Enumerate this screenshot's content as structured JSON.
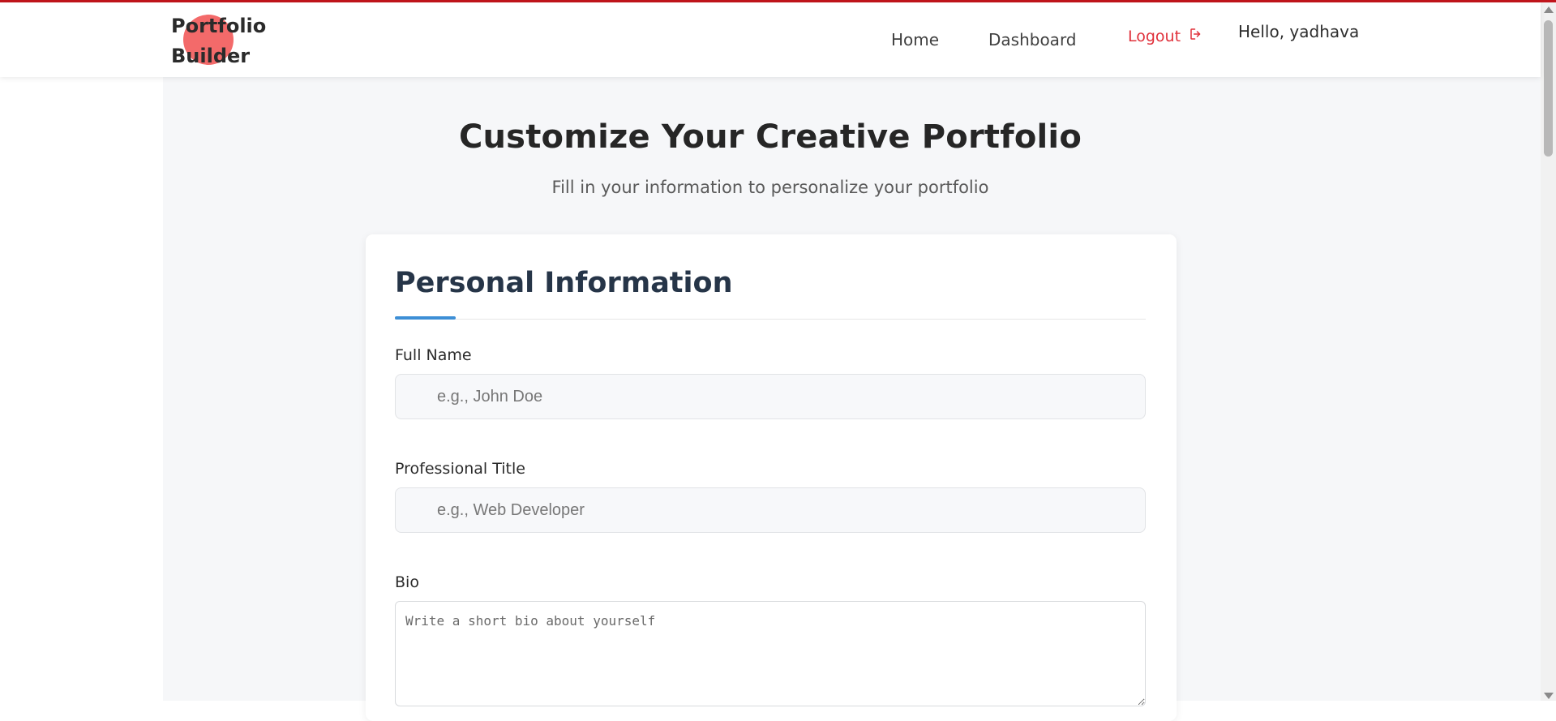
{
  "app": {
    "logo_text": "Portfolio Builder"
  },
  "nav": {
    "home": "Home",
    "dashboard": "Dashboard",
    "logout": "Logout",
    "greeting": "Hello, yadhava"
  },
  "hero": {
    "title": "Customize Your Creative Portfolio",
    "subtitle": "Fill in your information to personalize your portfolio"
  },
  "section": {
    "title": "Personal Information"
  },
  "form": {
    "full_name_label": "Full Name",
    "full_name_placeholder": "e.g., John Doe",
    "title_label": "Professional Title",
    "title_placeholder": "e.g., Web Developer",
    "bio_label": "Bio",
    "bio_placeholder": "Write a short bio about yourself"
  },
  "colors": {
    "accent": "#3d8fd6",
    "logout": "#e0303a",
    "logo_dot": "#f36a6a",
    "top_line": "#c0151b"
  },
  "icons": {
    "logout": "logout-icon"
  }
}
